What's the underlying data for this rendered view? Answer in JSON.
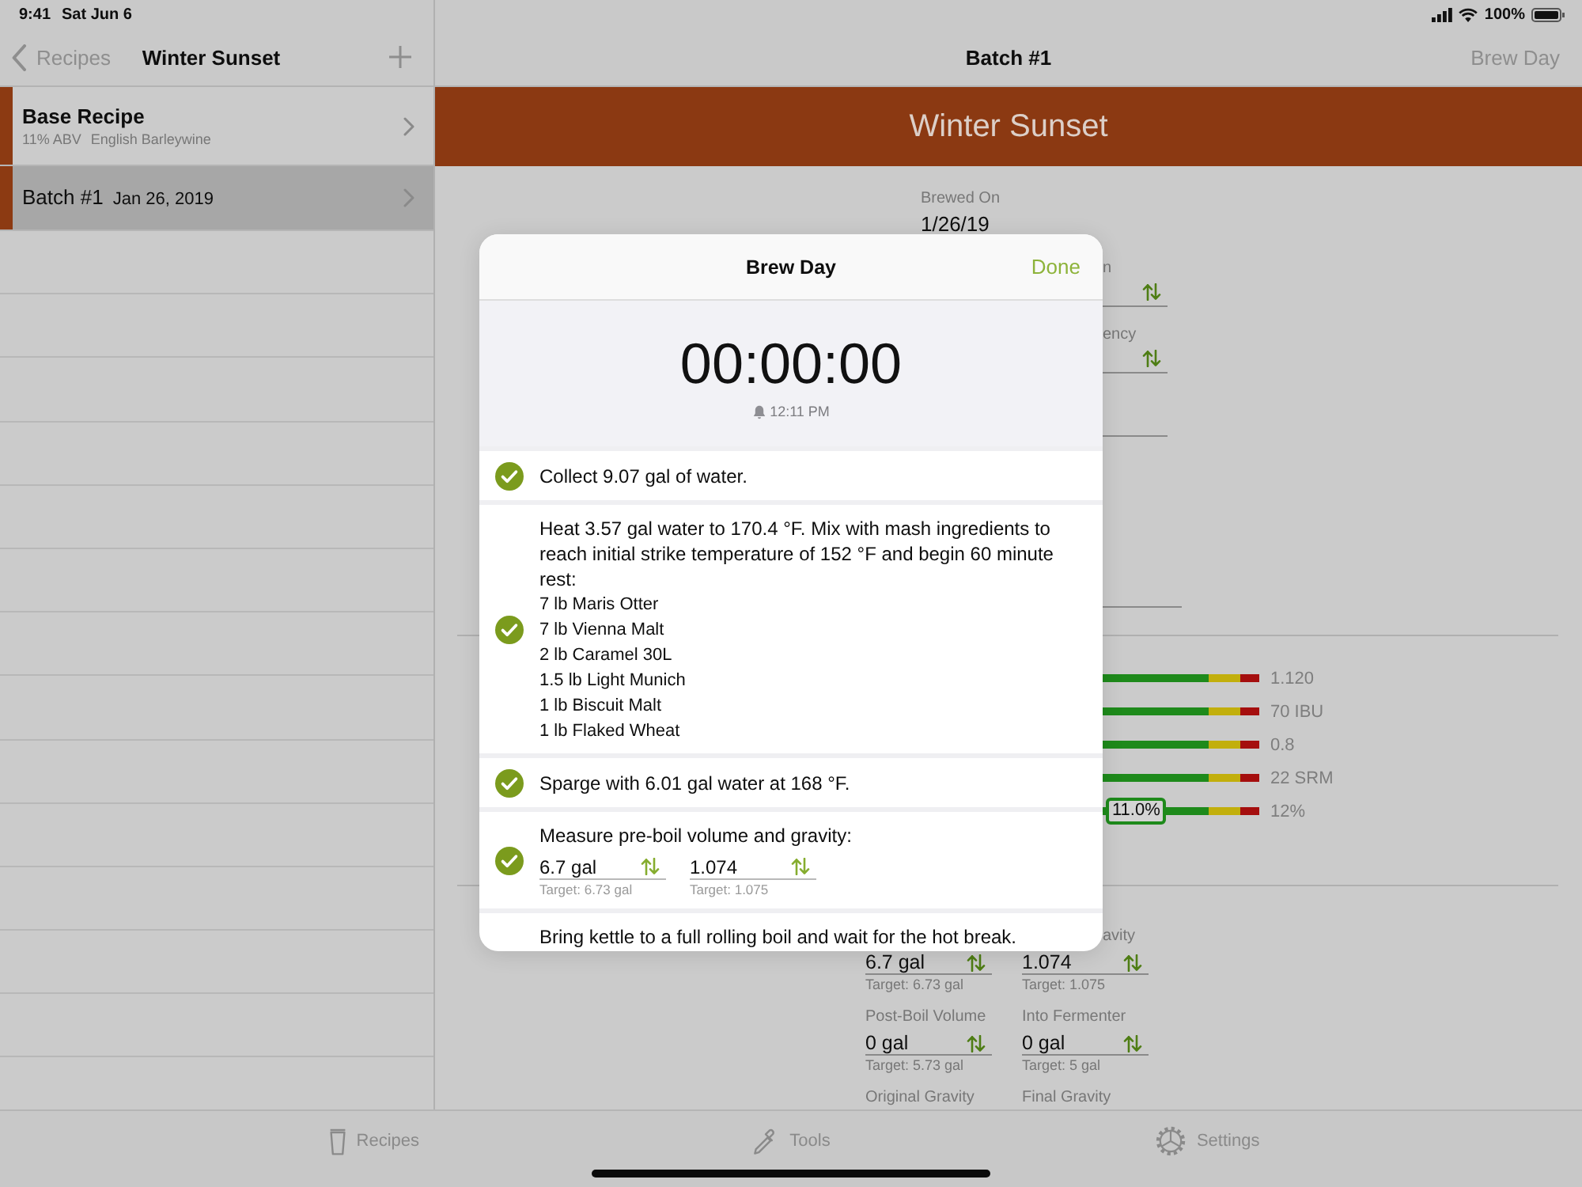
{
  "status_bar": {
    "time": "9:41",
    "date": "Sat Jun 6",
    "battery": "100%"
  },
  "sidebar": {
    "back": "Recipes",
    "title": "Winter Sunset",
    "items": [
      {
        "title": "Base Recipe",
        "details": [
          "11% ABV",
          "English Barleywine"
        ],
        "selected": false
      },
      {
        "title": "Batch #1",
        "date": "Jan 26, 2019",
        "selected": true
      }
    ]
  },
  "detail": {
    "title": "Batch #1",
    "action": "Brew Day",
    "banner": "Winter Sunset",
    "brewed": {
      "label": "Brewed On",
      "value": "1/26/19"
    },
    "side_fields": [
      {
        "kind": "stepper",
        "label": "n"
      },
      {
        "kind": "stepper",
        "label": "ency"
      },
      {
        "kind": "line"
      },
      {
        "kind": "notes"
      }
    ],
    "gauges": [
      {
        "reading": "1.120"
      },
      {
        "reading": "70 IBU"
      },
      {
        "reading": "0.8"
      },
      {
        "reading": "22 SRM"
      },
      {
        "reading": "12%",
        "marker": "11.0%"
      }
    ],
    "clipped_label": "avity",
    "measurements": [
      {
        "value": "6.7 gal",
        "target": "Target: 6.73 gal"
      },
      {
        "value": "1.074",
        "target": "Target: 1.075"
      },
      {
        "label": "Post-Boil Volume",
        "value": "0 gal",
        "target": "Target: 5.73 gal"
      },
      {
        "label": "Into Fermenter",
        "value": "0 gal",
        "target": "Target: 5 gal"
      },
      {
        "label": "Original Gravity"
      },
      {
        "label": "Final Gravity"
      }
    ]
  },
  "modal": {
    "title": "Brew Day",
    "done": "Done",
    "timer": "00:00:00",
    "alarm": "12:11 PM",
    "steps": [
      {
        "text": "Collect 9.07 gal of water.",
        "checked": true
      },
      {
        "text": "Heat 3.57 gal water to 170.4 °F. Mix with mash ingredients to reach initial strike temperature of 152 °F and begin 60 minute rest:",
        "ingredients": [
          "7 lb Maris Otter",
          "7 lb Vienna Malt",
          "2 lb Caramel 30L",
          "1.5 lb Light Munich",
          "1 lb Biscuit Malt",
          "1 lb Flaked Wheat"
        ],
        "checked": true
      },
      {
        "text": "Sparge with 6.01 gal water at 168 °F.",
        "checked": true
      },
      {
        "text": "Measure pre-boil volume and gravity:",
        "fields": [
          {
            "value": "6.7 gal",
            "target": "Target: 6.73 gal"
          },
          {
            "value": "1.074",
            "target": "Target: 1.075"
          }
        ],
        "checked": true
      },
      {
        "text": "Bring kettle to a full rolling boil and wait for the hot break."
      }
    ]
  },
  "tab_bar": [
    {
      "label": "Recipes",
      "selected": false
    },
    {
      "label": "Tools",
      "selected": false
    },
    {
      "label": "Settings",
      "selected": false
    }
  ]
}
